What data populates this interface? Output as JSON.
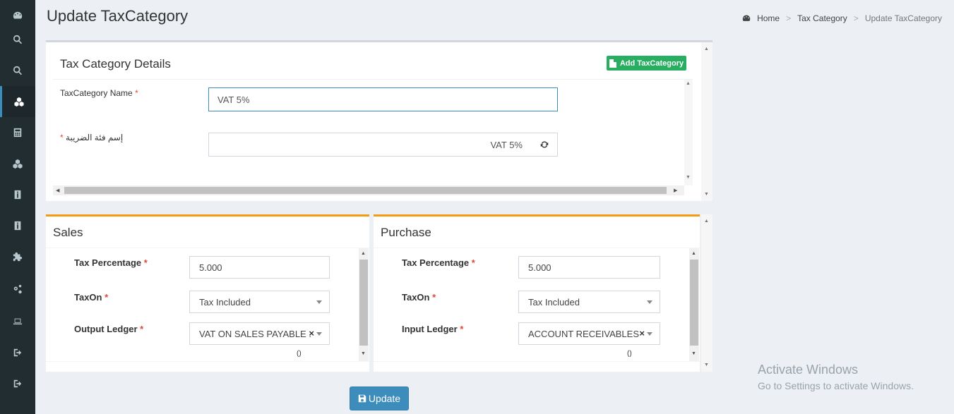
{
  "sidebar": {
    "items": [
      {
        "icon": "dashboard-icon"
      },
      {
        "icon": "search-icon"
      },
      {
        "icon": "search-icon"
      },
      {
        "icon": "cubes-icon"
      },
      {
        "icon": "calculator-icon"
      },
      {
        "icon": "cubes-icon"
      },
      {
        "icon": "info-icon"
      },
      {
        "icon": "info-icon"
      },
      {
        "icon": "puzzle-icon"
      },
      {
        "icon": "cogs-icon"
      },
      {
        "icon": "laptop-icon"
      },
      {
        "icon": "sign-out-icon"
      },
      {
        "icon": "sign-out-icon"
      }
    ],
    "active_index": 3
  },
  "header": {
    "title": "Update TaxCategory",
    "breadcrumb": {
      "home": "Home",
      "parent": "Tax Category",
      "current": "Update TaxCategory"
    }
  },
  "details": {
    "title": "Tax Category Details",
    "add_button": "Add TaxCategory",
    "name_label": "TaxCategory Name",
    "name_value": "VAT 5%",
    "arabic_label": "إسم فئة الضريبة",
    "arabic_value": "VAT 5%",
    "required_mark": "*"
  },
  "sales": {
    "title": "Sales",
    "tax_percentage_label": "Tax Percentage",
    "tax_percentage_value": "5.000",
    "tax_on_label": "TaxOn",
    "tax_on_value": "Tax Included",
    "ledger_label": "Output Ledger",
    "ledger_value": "VAT ON SALES PAYABLE ...",
    "ledger_note": "()"
  },
  "purchase": {
    "title": "Purchase",
    "tax_percentage_label": "Tax Percentage",
    "tax_percentage_value": "5.000",
    "tax_on_label": "TaxOn",
    "tax_on_value": "Tax Included",
    "ledger_label": "Input Ledger",
    "ledger_value": "ACCOUNT RECEIVABLES ...",
    "ledger_note": "()"
  },
  "actions": {
    "update_label": "Update"
  },
  "watermark": {
    "title": "Activate Windows",
    "subtitle": "Go to Settings to activate Windows."
  },
  "colors": {
    "sidebar_bg": "#222d32",
    "accent": "#3c8dbc",
    "success": "#27ae60",
    "warning": "#f39c12",
    "required": "#dd4b39"
  }
}
